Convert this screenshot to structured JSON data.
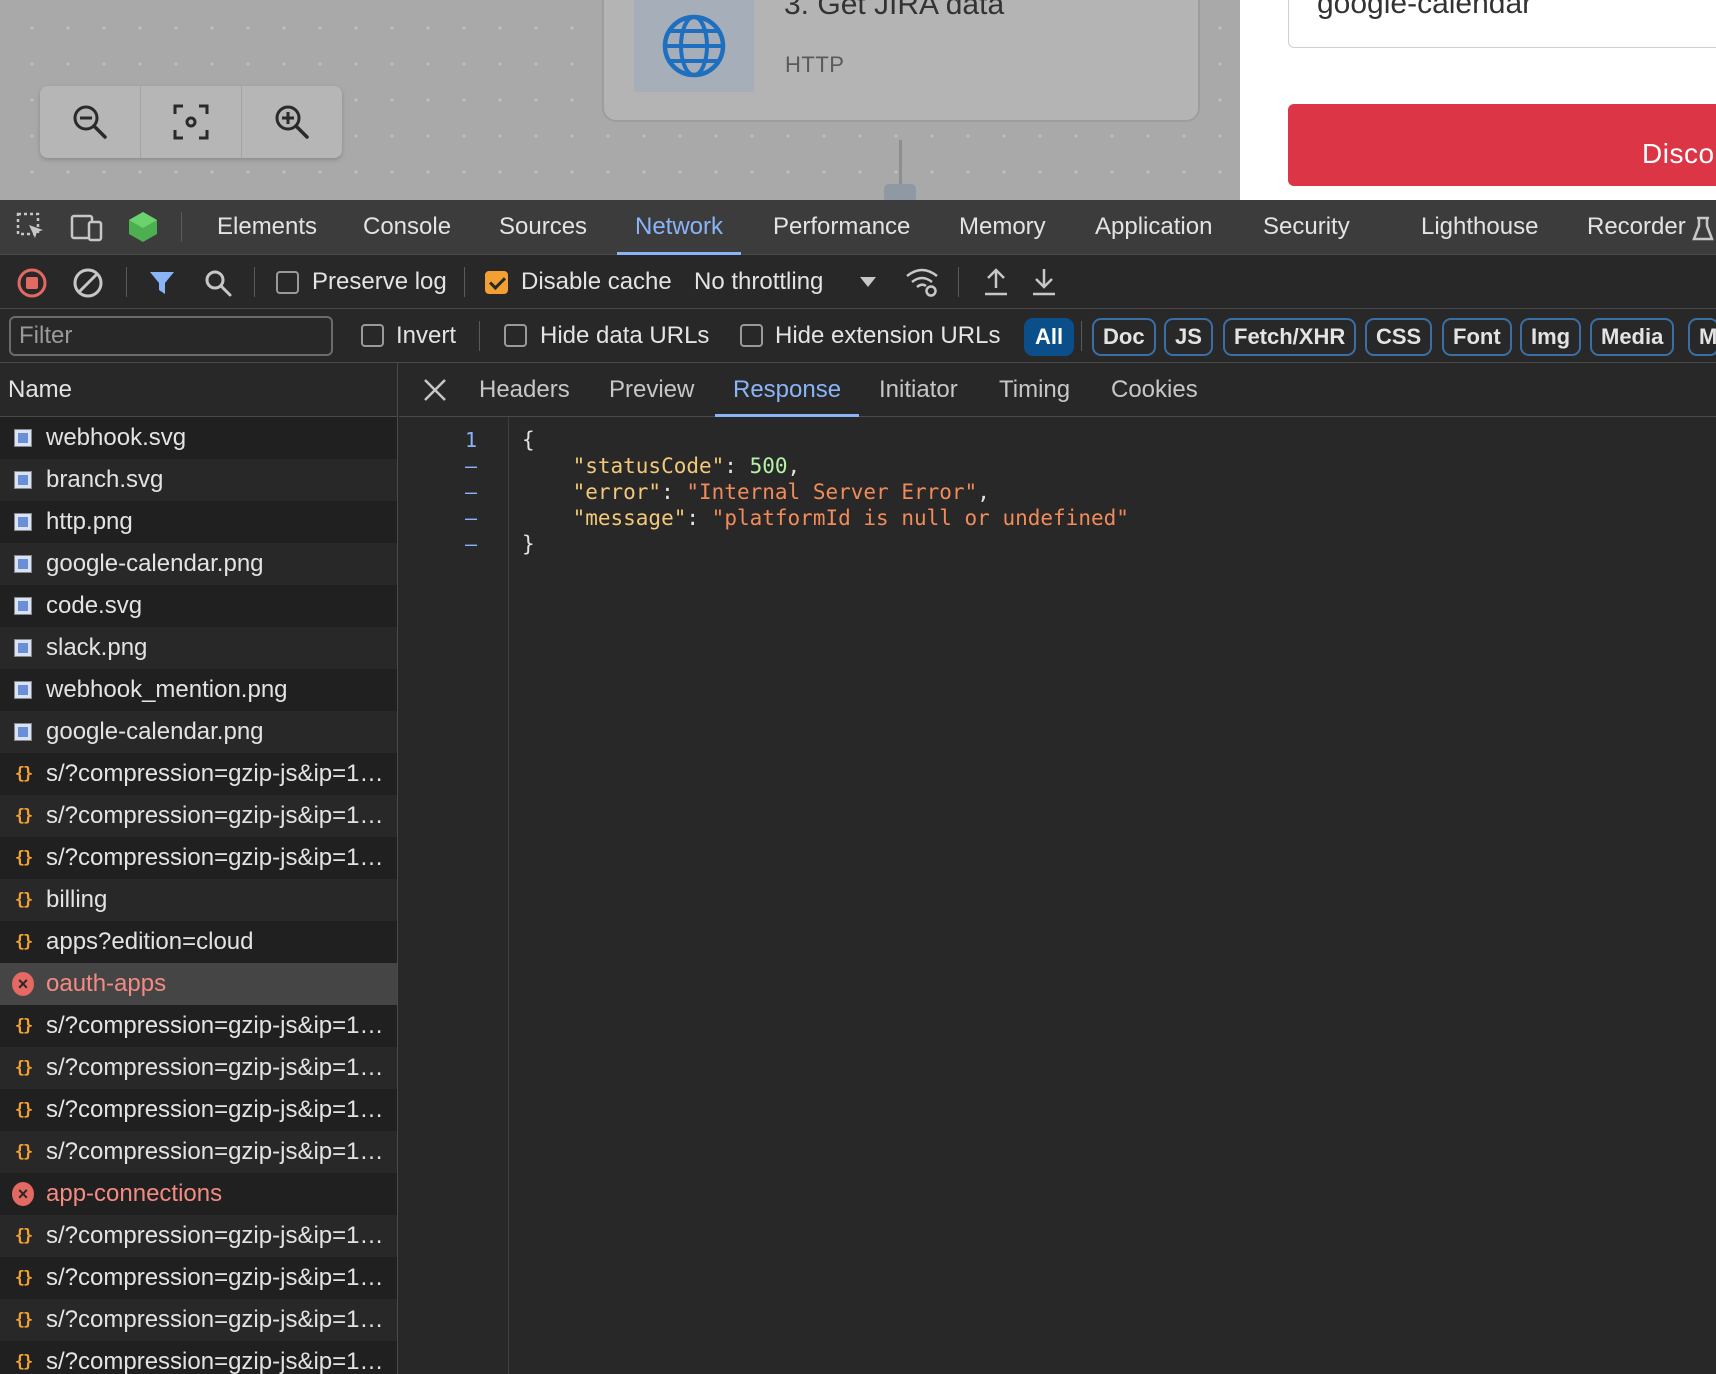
{
  "background_app": {
    "node": {
      "title": "3. Get JIRA data",
      "type": "HTTP"
    },
    "search_value": "google-calendar",
    "button_label": "Disco",
    "zoom_controls": [
      "zoom-out-icon",
      "fit-view-icon",
      "zoom-in-icon"
    ]
  },
  "devtools": {
    "tabs": [
      "Elements",
      "Console",
      "Sources",
      "Network",
      "Performance",
      "Memory",
      "Application",
      "Security",
      "Lighthouse",
      "Recorder"
    ],
    "active_tab": "Network",
    "toolbar": {
      "preserve_log": {
        "label": "Preserve log",
        "checked": false
      },
      "disable_cache": {
        "label": "Disable cache",
        "checked": true
      },
      "throttling": "No throttling"
    },
    "filter": {
      "placeholder": "Filter",
      "invert": "Invert",
      "hide_data_urls": "Hide data URLs",
      "hide_extension_urls": "Hide extension URLs",
      "types": [
        "All",
        "Doc",
        "JS",
        "Fetch/XHR",
        "CSS",
        "Font",
        "Img",
        "Media",
        "M"
      ],
      "active_type": "All"
    },
    "name_column_header": "Name",
    "requests": [
      {
        "name": "webhook.svg",
        "kind": "img"
      },
      {
        "name": "branch.svg",
        "kind": "img"
      },
      {
        "name": "http.png",
        "kind": "img"
      },
      {
        "name": "google-calendar.png",
        "kind": "img"
      },
      {
        "name": "code.svg",
        "kind": "img"
      },
      {
        "name": "slack.png",
        "kind": "img"
      },
      {
        "name": "webhook_mention.png",
        "kind": "img"
      },
      {
        "name": "google-calendar.png",
        "kind": "img"
      },
      {
        "name": "s/?compression=gzip-js&ip=1…",
        "kind": "js"
      },
      {
        "name": "s/?compression=gzip-js&ip=1…",
        "kind": "js"
      },
      {
        "name": "s/?compression=gzip-js&ip=1…",
        "kind": "js"
      },
      {
        "name": "billing",
        "kind": "js"
      },
      {
        "name": "apps?edition=cloud",
        "kind": "js"
      },
      {
        "name": "oauth-apps",
        "kind": "error",
        "selected": true
      },
      {
        "name": "s/?compression=gzip-js&ip=1…",
        "kind": "js"
      },
      {
        "name": "s/?compression=gzip-js&ip=1…",
        "kind": "js"
      },
      {
        "name": "s/?compression=gzip-js&ip=1…",
        "kind": "js"
      },
      {
        "name": "s/?compression=gzip-js&ip=1…",
        "kind": "js"
      },
      {
        "name": "app-connections",
        "kind": "error"
      },
      {
        "name": "s/?compression=gzip-js&ip=1…",
        "kind": "js"
      },
      {
        "name": "s/?compression=gzip-js&ip=1…",
        "kind": "js"
      },
      {
        "name": "s/?compression=gzip-js&ip=1…",
        "kind": "js"
      },
      {
        "name": "s/?compression=gzip-js&ip=1…",
        "kind": "js"
      }
    ],
    "detail_tabs": [
      "Headers",
      "Preview",
      "Response",
      "Initiator",
      "Timing",
      "Cookies"
    ],
    "active_detail_tab": "Response",
    "response": {
      "gutter": [
        "1",
        "–",
        "–",
        "–",
        "–"
      ],
      "lines": [
        [
          {
            "t": "{",
            "c": ""
          }
        ],
        [
          {
            "t": "    ",
            "c": ""
          },
          {
            "t": "\"statusCode\"",
            "c": "key"
          },
          {
            "t": ": ",
            "c": ""
          },
          {
            "t": "500",
            "c": "num"
          },
          {
            "t": ",",
            "c": ""
          }
        ],
        [
          {
            "t": "    ",
            "c": ""
          },
          {
            "t": "\"error\"",
            "c": "key"
          },
          {
            "t": ": ",
            "c": ""
          },
          {
            "t": "\"Internal Server Error\"",
            "c": "str"
          },
          {
            "t": ",",
            "c": ""
          }
        ],
        [
          {
            "t": "    ",
            "c": ""
          },
          {
            "t": "\"message\"",
            "c": "key"
          },
          {
            "t": ": ",
            "c": ""
          },
          {
            "t": "\"platformId is null or undefined\"",
            "c": "str"
          }
        ],
        [
          {
            "t": "}",
            "c": ""
          }
        ]
      ]
    }
  }
}
